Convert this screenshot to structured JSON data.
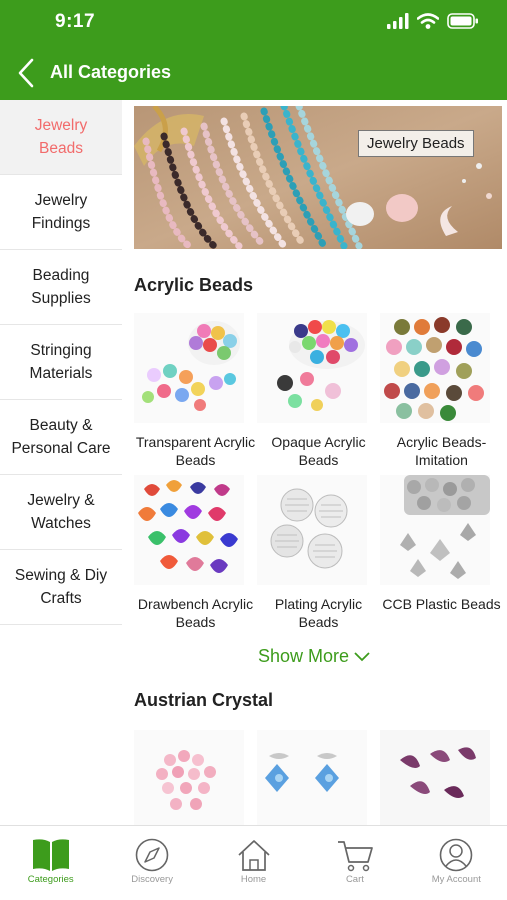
{
  "status_bar": {
    "time": "9:17"
  },
  "header": {
    "title": "All Categories"
  },
  "colors": {
    "brand": "#3d9c1c",
    "active_category": "#f26b6b"
  },
  "sidebar": {
    "items": [
      {
        "label": "Jewelry Beads",
        "active": true
      },
      {
        "label": "Jewelry Findings"
      },
      {
        "label": "Beading Supplies"
      },
      {
        "label": "Stringing Materials"
      },
      {
        "label": "Beauty & Personal Care"
      },
      {
        "label": "Jewelry & Watches"
      },
      {
        "label": "Sewing & Diy Crafts"
      }
    ]
  },
  "banner": {
    "label": "Jewelry Beads"
  },
  "sections": [
    {
      "title": "Acrylic Beads",
      "products": [
        {
          "name": "Transparent Acrylic Beads"
        },
        {
          "name": "Opaque Acrylic Beads"
        },
        {
          "name": "Acrylic Beads-Imitation"
        },
        {
          "name": "Drawbench Acrylic Beads"
        },
        {
          "name": "Plating Acrylic Beads"
        },
        {
          "name": "CCB Plastic Beads"
        }
      ],
      "show_more": "Show More"
    },
    {
      "title": "Austrian Crystal"
    }
  ],
  "tabbar": {
    "tabs": [
      {
        "label": "Categories",
        "icon": "book-icon",
        "active": true
      },
      {
        "label": "Discovery",
        "icon": "compass-icon"
      },
      {
        "label": "Home",
        "icon": "home-icon"
      },
      {
        "label": "Cart",
        "icon": "cart-icon"
      },
      {
        "label": "My Account",
        "icon": "account-icon"
      }
    ]
  }
}
